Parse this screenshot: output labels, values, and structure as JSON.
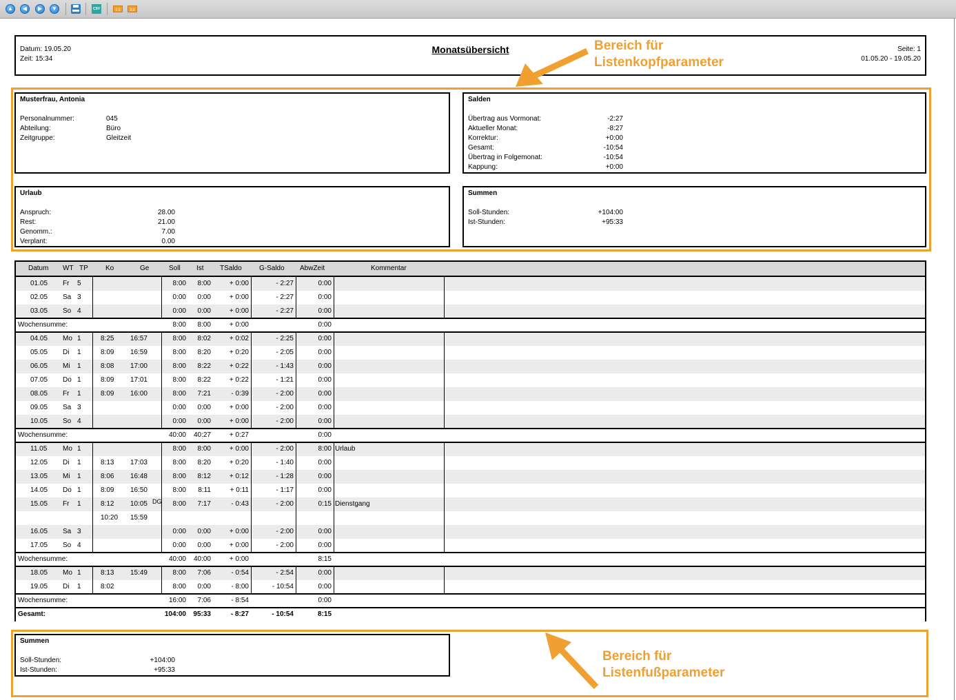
{
  "toolbar": {
    "buttons": [
      {
        "name": "first-page-icon",
        "glyph": "▲"
      },
      {
        "name": "previous-page-icon",
        "glyph": "◀"
      },
      {
        "name": "next-page-icon",
        "glyph": "▶"
      },
      {
        "name": "last-page-icon",
        "glyph": "▼"
      }
    ],
    "csv_label": "CSV",
    "export1_label": "1:1",
    "export2_label": "2:2"
  },
  "header": {
    "datum": "Datum: 19.05.20",
    "zeit": "Zeit: 15:34",
    "title": "Monatsübersicht",
    "seite": "Seite: 1",
    "zeitraum": "01.05.20 - 19.05.20"
  },
  "callouts": {
    "top_line1": "Bereich für",
    "top_line2": "Listenkopfparameter",
    "bottom_line1": "Bereich für",
    "bottom_line2": "Listenfußparameter"
  },
  "person": {
    "name": "Musterfrau, Antonia",
    "fields": [
      {
        "label": "Personalnummer:",
        "value": "045"
      },
      {
        "label": "Abteilung:",
        "value": "Büro"
      },
      {
        "label": "Zeitgruppe:",
        "value": "Gleitzeit"
      }
    ]
  },
  "salden": {
    "title": "Salden",
    "fields": [
      {
        "label": "Übertrag aus Vormonat:",
        "value": "-2:27"
      },
      {
        "label": "Aktueller Monat:",
        "value": "-8:27"
      },
      {
        "label": "Korrektur:",
        "value": "+0:00"
      },
      {
        "label": "Gesamt:",
        "value": "-10:54"
      },
      {
        "label": "Übertrag in Folgemonat:",
        "value": "-10:54"
      },
      {
        "label": "Kappung:",
        "value": "+0:00"
      }
    ]
  },
  "urlaub": {
    "title": "Urlaub",
    "fields": [
      {
        "label": "Anspruch:",
        "value": "28.00"
      },
      {
        "label": "Rest:",
        "value": "21.00"
      },
      {
        "label": "Genomm.:",
        "value": "7.00"
      },
      {
        "label": "Verplant:",
        "value": "0.00"
      }
    ]
  },
  "summen_top": {
    "title": "Summen",
    "fields": [
      {
        "label": "Soll-Stunden:",
        "value": "+104:00"
      },
      {
        "label": "Ist-Stunden:",
        "value": "+95:33"
      }
    ]
  },
  "summen_bottom": {
    "title": "Summen",
    "fields": [
      {
        "label": "Soll-Stunden:",
        "value": "+104:00"
      },
      {
        "label": "Ist-Stunden:",
        "value": "+95:33"
      }
    ]
  },
  "table": {
    "columns": [
      "Datum",
      "WT",
      "TP",
      "Ko",
      "Ge",
      "Soll",
      "Ist",
      "TSaldo",
      "G-Saldo",
      "AbwZeit",
      "Kommentar"
    ],
    "rows": [
      {
        "type": "day",
        "datum": "01.05",
        "wt": "Fr",
        "tp": "5",
        "ko": "",
        "ge": "",
        "soll": "8:00",
        "ist": "8:00",
        "tsaldo": "+ 0:00",
        "gsaldo": "- 2:27",
        "abw": "0:00",
        "kommentar": ""
      },
      {
        "type": "day",
        "datum": "02.05",
        "wt": "Sa",
        "tp": "3",
        "ko": "",
        "ge": "",
        "soll": "0:00",
        "ist": "0:00",
        "tsaldo": "+ 0:00",
        "gsaldo": "- 2:27",
        "abw": "0:00",
        "kommentar": ""
      },
      {
        "type": "day",
        "datum": "03.05",
        "wt": "So",
        "tp": "4",
        "ko": "",
        "ge": "",
        "soll": "0:00",
        "ist": "0:00",
        "tsaldo": "+ 0:00",
        "gsaldo": "- 2:27",
        "abw": "0:00",
        "kommentar": ""
      },
      {
        "type": "sum",
        "label": "Wochensumme:",
        "soll": "8:00",
        "ist": "8:00",
        "tsaldo": "+ 0:00",
        "abw": "0:00"
      },
      {
        "type": "day",
        "datum": "04.05",
        "wt": "Mo",
        "tp": "1",
        "ko": "8:25",
        "ge": "16:57",
        "soll": "8:00",
        "ist": "8:02",
        "tsaldo": "+ 0:02",
        "gsaldo": "- 2:25",
        "abw": "0:00",
        "kommentar": ""
      },
      {
        "type": "day",
        "datum": "05.05",
        "wt": "Di",
        "tp": "1",
        "ko": "8:09",
        "ge": "16:59",
        "soll": "8:00",
        "ist": "8:20",
        "tsaldo": "+ 0:20",
        "gsaldo": "- 2:05",
        "abw": "0:00",
        "kommentar": ""
      },
      {
        "type": "day",
        "datum": "06.05",
        "wt": "Mi",
        "tp": "1",
        "ko": "8:08",
        "ge": "17:00",
        "soll": "8:00",
        "ist": "8:22",
        "tsaldo": "+ 0:22",
        "gsaldo": "- 1:43",
        "abw": "0:00",
        "kommentar": ""
      },
      {
        "type": "day",
        "datum": "07.05",
        "wt": "Do",
        "tp": "1",
        "ko": "8:09",
        "ge": "17:01",
        "soll": "8:00",
        "ist": "8:22",
        "tsaldo": "+ 0:22",
        "gsaldo": "- 1:21",
        "abw": "0:00",
        "kommentar": ""
      },
      {
        "type": "day",
        "datum": "08.05",
        "wt": "Fr",
        "tp": "1",
        "ko": "8:09",
        "ge": "16:00",
        "soll": "8:00",
        "ist": "7:21",
        "tsaldo": "- 0:39",
        "gsaldo": "- 2:00",
        "abw": "0:00",
        "kommentar": ""
      },
      {
        "type": "day",
        "datum": "09.05",
        "wt": "Sa",
        "tp": "3",
        "ko": "",
        "ge": "",
        "soll": "0:00",
        "ist": "0:00",
        "tsaldo": "+ 0:00",
        "gsaldo": "- 2:00",
        "abw": "0:00",
        "kommentar": ""
      },
      {
        "type": "day",
        "datum": "10.05",
        "wt": "So",
        "tp": "4",
        "ko": "",
        "ge": "",
        "soll": "0:00",
        "ist": "0:00",
        "tsaldo": "+ 0:00",
        "gsaldo": "- 2:00",
        "abw": "0:00",
        "kommentar": ""
      },
      {
        "type": "sum",
        "label": "Wochensumme:",
        "soll": "40:00",
        "ist": "40:27",
        "tsaldo": "+ 0:27",
        "abw": "0:00"
      },
      {
        "type": "day",
        "datum": "11.05",
        "wt": "Mo",
        "tp": "1",
        "ko": "",
        "ge": "",
        "soll": "8:00",
        "ist": "8:00",
        "tsaldo": "+ 0:00",
        "gsaldo": "- 2:00",
        "abw": "8:00",
        "kommentar": "Urlaub"
      },
      {
        "type": "day",
        "datum": "12.05",
        "wt": "Di",
        "tp": "1",
        "ko": "8:13",
        "ge": "17:03",
        "soll": "8:00",
        "ist": "8:20",
        "tsaldo": "+ 0:20",
        "gsaldo": "- 1:40",
        "abw": "0:00",
        "kommentar": ""
      },
      {
        "type": "day",
        "datum": "13.05",
        "wt": "Mi",
        "tp": "1",
        "ko": "8:06",
        "ge": "16:48",
        "soll": "8:00",
        "ist": "8:12",
        "tsaldo": "+ 0:12",
        "gsaldo": "- 1:28",
        "abw": "0:00",
        "kommentar": ""
      },
      {
        "type": "day",
        "datum": "14.05",
        "wt": "Do",
        "tp": "1",
        "ko": "8:09",
        "ge": "16:50",
        "soll": "8:00",
        "ist": "8:11",
        "tsaldo": "+ 0:11",
        "gsaldo": "- 1:17",
        "abw": "0:00",
        "kommentar": ""
      },
      {
        "type": "day",
        "datum": "15.05",
        "wt": "Fr",
        "tp": "1",
        "ko": "8:12",
        "ge": "10:05",
        "ge_mark": "DG",
        "soll": "8:00",
        "ist": "7:17",
        "tsaldo": "- 0:43",
        "gsaldo": "- 2:00",
        "abw": "0:15",
        "kommentar": "Dienstgang"
      },
      {
        "type": "day",
        "datum": "",
        "wt": "",
        "tp": "",
        "ko": "10:20",
        "ge": "15:59",
        "soll": "",
        "ist": "",
        "tsaldo": "",
        "gsaldo": "",
        "abw": "",
        "kommentar": ""
      },
      {
        "type": "day",
        "datum": "16.05",
        "wt": "Sa",
        "tp": "3",
        "ko": "",
        "ge": "",
        "soll": "0:00",
        "ist": "0:00",
        "tsaldo": "+ 0:00",
        "gsaldo": "- 2:00",
        "abw": "0:00",
        "kommentar": ""
      },
      {
        "type": "day",
        "datum": "17.05",
        "wt": "So",
        "tp": "4",
        "ko": "",
        "ge": "",
        "soll": "0:00",
        "ist": "0:00",
        "tsaldo": "+ 0:00",
        "gsaldo": "- 2:00",
        "abw": "0:00",
        "kommentar": ""
      },
      {
        "type": "sum",
        "label": "Wochensumme:",
        "soll": "40:00",
        "ist": "40:00",
        "tsaldo": "+ 0:00",
        "abw": "8:15"
      },
      {
        "type": "day",
        "datum": "18.05",
        "wt": "Mo",
        "tp": "1",
        "ko": "8:13",
        "ge": "15:49",
        "soll": "8:00",
        "ist": "7:06",
        "tsaldo": "- 0:54",
        "gsaldo": "- 2:54",
        "abw": "0:00",
        "kommentar": ""
      },
      {
        "type": "day",
        "datum": "19.05",
        "wt": "Di",
        "tp": "1",
        "ko": "8:02",
        "ge": "",
        "soll": "8:00",
        "ist": "0:00",
        "tsaldo": "- 8:00",
        "gsaldo": "- 10:54",
        "abw": "0:00",
        "kommentar": ""
      },
      {
        "type": "sum",
        "label": "Wochensumme:",
        "soll": "16:00",
        "ist": "7:06",
        "tsaldo": "- 8:54",
        "abw": "0:00"
      },
      {
        "type": "total",
        "label": "Gesamt:",
        "soll": "104:00",
        "ist": "95:33",
        "tsaldo": "- 8:27",
        "gsaldo": "- 10:54",
        "abw": "8:15"
      }
    ]
  }
}
